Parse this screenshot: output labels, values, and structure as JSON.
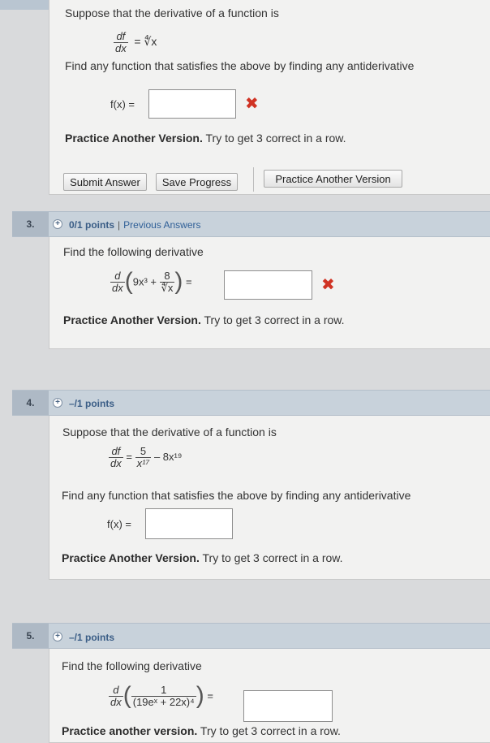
{
  "q2": {
    "intro": "Suppose that the derivative of a function is",
    "df": "df",
    "dx": "dx",
    "rhs": "= ∜x",
    "find": "Find any function that satisfies the above by finding any antiderivative",
    "fx_label": "f(x) =",
    "practice_bold": "Practice Another Version.",
    "practice_rest": " Try to get 3 correct in a row.",
    "buttons": {
      "submit": "Submit Answer",
      "save": "Save Progress",
      "practice": "Practice Another Version"
    }
  },
  "q3": {
    "number": "3.",
    "points": "0/1 points",
    "sep": "|",
    "previous": "Previous Answers",
    "prompt": "Find the following derivative",
    "d": "d",
    "dx": "dx",
    "term1": "9x³ +",
    "num8": "8",
    "den": "∜x",
    "equals": "=",
    "practice_bold": "Practice Another Version.",
    "practice_rest": " Try to get 3 correct in a row."
  },
  "q4": {
    "number": "4.",
    "points": "–/1 points",
    "intro": "Suppose that the derivative of a function is",
    "df": "df",
    "dx": "dx",
    "eq": "=",
    "num5": "5",
    "den": "x¹⁷",
    "minus": "– 8x¹⁹",
    "find": "Find any function that satisfies the above by finding any antiderivative",
    "fx_label": "f(x) =",
    "practice_bold": "Practice Another Version.",
    "practice_rest": " Try to get 3 correct in a row."
  },
  "q5": {
    "number": "5.",
    "points": "–/1 points",
    "prompt": "Find the following derivative",
    "d": "d",
    "dx": "dx",
    "num1": "1",
    "den": "(19eˣ + 22x)⁴",
    "equals": "=",
    "practice_bold": "Practice another version.",
    "practice_rest": " Try to get 3 correct in a row."
  },
  "colors": {
    "wrong": "#d03324",
    "link": "#2f5f97",
    "header_bar": "#c8d2db"
  },
  "icons": {
    "wrong": "✖",
    "expand": "+"
  }
}
